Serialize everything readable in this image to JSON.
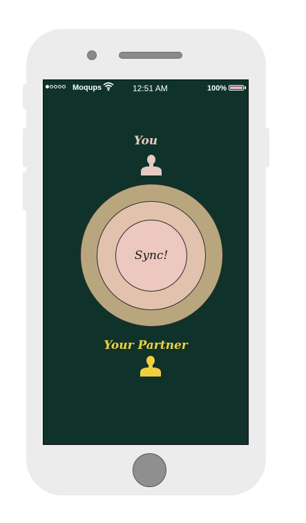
{
  "status_bar": {
    "carrier": "Moqups",
    "time": "12:51 AM",
    "battery": "100%"
  },
  "screen": {
    "you_label": "You",
    "sync_label": "Sync!",
    "partner_label": "Your Partner"
  },
  "colors": {
    "background": "#0f332b",
    "you_accent": "#e6c9c3",
    "partner_accent": "#f2cf3f",
    "outer_ring": "#b8a67e",
    "middle_ring": "#e2c2ac",
    "inner_ring": "#ecc8c0"
  },
  "icons": {
    "you": "person-icon",
    "partner": "person-icon",
    "wifi": "wifi-icon",
    "battery": "battery-icon"
  }
}
